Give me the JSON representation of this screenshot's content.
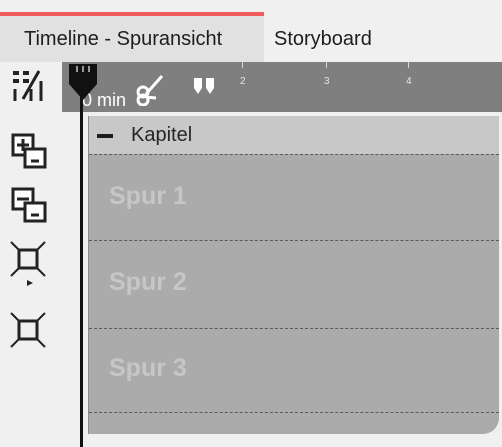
{
  "tabs": {
    "timeline": "Timeline - Spuransicht",
    "storyboard": "Storyboard"
  },
  "tools": [
    {
      "icon": "split-icon"
    },
    {
      "icon": "add-track-icon"
    },
    {
      "icon": "remove-track-icon"
    },
    {
      "icon": "collapse-icon"
    },
    {
      "icon": "expand-icon"
    }
  ],
  "ruler": {
    "zero": "0 min",
    "ticks": [
      "2",
      "3",
      "4"
    ]
  },
  "chapter": {
    "label": "Kapitel",
    "tracks": [
      "Spur 1",
      "Spur 2",
      "Spur 3"
    ]
  },
  "colors": {
    "accent": "#f05a5a",
    "ruler": "#7f7f7f",
    "chapter": "#ababab"
  }
}
